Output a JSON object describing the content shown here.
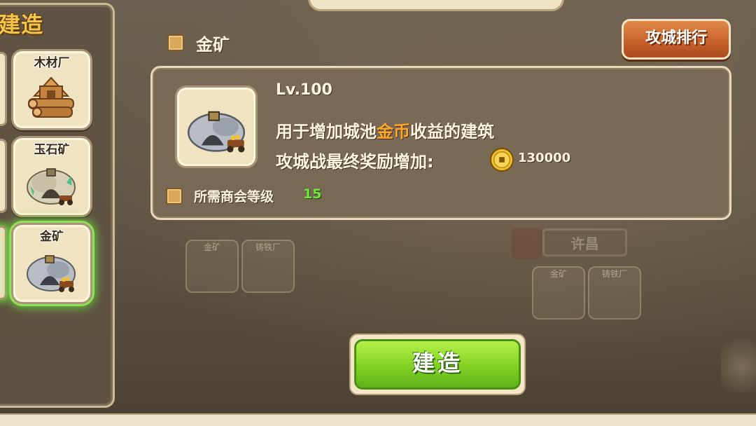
{
  "left_panel": {
    "title": "建造",
    "items": [
      {
        "label": "木材厂",
        "icon": "lumber-mill-icon",
        "selected": false
      },
      {
        "label": "玉石矿",
        "icon": "jade-mine-icon",
        "selected": false
      },
      {
        "label": "金矿",
        "icon": "gold-mine-icon",
        "selected": true
      }
    ]
  },
  "header": {
    "title": "金矿",
    "rank_button": "攻城排行"
  },
  "info": {
    "level": "Lv.100",
    "desc_prefix": "用于增加城池",
    "desc_highlight": "金币",
    "desc_suffix": "收益的建筑",
    "reward_label": "攻城战最终奖励增加:",
    "reward_amount": "130000",
    "requirement_label": "所需商会等级",
    "requirement_value": "15"
  },
  "build_button": "建造",
  "map": {
    "city_label": "许昌",
    "cards_left": [
      "金矿",
      "铸铁厂"
    ],
    "cards_right": [
      "金矿",
      "铸铁厂"
    ]
  },
  "colors": {
    "gold_highlight": "#ffa52a",
    "requirement_green": "#6ee83a",
    "title_gold": "#f6c547",
    "build_green": "#86d325",
    "rank_orange": "#c7602a"
  }
}
